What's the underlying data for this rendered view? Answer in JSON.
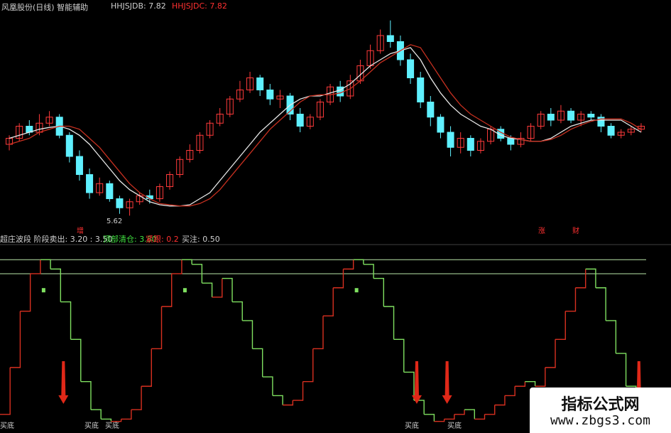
{
  "top_header": {
    "stock_name": "风凰股份(日线) 智能辅助",
    "db_label": "HHJSJDB: 7.82",
    "dc_label": "HHJSJDC: 7.82"
  },
  "top_annotations": {
    "low_price": "5.62",
    "low_tag": "增",
    "right_tags": [
      "涨",
      "财"
    ]
  },
  "bottom_header": {
    "indicator_name": "超庄波段 阶段卖出: 3.20 : 3.50",
    "top_clear": "顶部清仓: 3.50",
    "escape": "紧跟: 0.2",
    "fill": "买注: 0.50"
  },
  "buy_labels": [
    "买底",
    "买底",
    "买底",
    "买底",
    "买底"
  ],
  "watermark": {
    "line1": "指标公式网",
    "line2": "www.zbgs3.com"
  },
  "colors": {
    "up": "#ff3a3a",
    "down": "#5ff0ff",
    "ma_white": "#e8e8e8",
    "ma_red": "#c83020",
    "osc_red": "#d83020",
    "osc_green": "#7fe060",
    "hline": "#b9e6a8",
    "arrow": "#e02818",
    "header_white": "#d0d0d0",
    "header_red": "#ff3030",
    "header_green": "#40e040",
    "header_yellow": "#e0c000"
  },
  "chart_data": [
    {
      "type": "candlestick",
      "title": "风凰股份(日线)",
      "series": [
        {
          "name": "HHJSJDB",
          "kind": "ma_white",
          "values": [
            6.9,
            6.95,
            7.0,
            7.05,
            7.08,
            7.1,
            7.05,
            6.95,
            6.8,
            6.6,
            6.4,
            6.2,
            6.05,
            5.95,
            5.85,
            5.8,
            5.78,
            5.78,
            5.8,
            5.9,
            6.0,
            6.2,
            6.4,
            6.6,
            6.8,
            7.0,
            7.15,
            7.3,
            7.45,
            7.55,
            7.6,
            7.6,
            7.65,
            7.7,
            7.8,
            7.95,
            8.1,
            8.2,
            8.3,
            8.35,
            8.4,
            8.2,
            7.9,
            7.65,
            7.45,
            7.3,
            7.2,
            7.1,
            7.05,
            6.95,
            6.9,
            6.88,
            6.85,
            6.85,
            6.9,
            7.0,
            7.1,
            7.15,
            7.2,
            7.2,
            7.2,
            7.2,
            7.1,
            7.0
          ]
        },
        {
          "name": "HHJSJDC",
          "kind": "ma_red",
          "values": [
            6.8,
            6.85,
            6.9,
            7.0,
            7.05,
            7.1,
            7.1,
            7.05,
            6.9,
            6.75,
            6.55,
            6.35,
            6.15,
            6.0,
            5.9,
            5.82,
            5.8,
            5.78,
            5.78,
            5.82,
            5.9,
            6.05,
            6.25,
            6.45,
            6.65,
            6.85,
            7.05,
            7.2,
            7.35,
            7.5,
            7.6,
            7.62,
            7.62,
            7.65,
            7.72,
            7.85,
            8.0,
            8.15,
            8.25,
            8.35,
            8.45,
            8.4,
            8.15,
            7.9,
            7.65,
            7.45,
            7.3,
            7.2,
            7.1,
            7.0,
            6.92,
            6.88,
            6.85,
            6.85,
            6.88,
            6.95,
            7.05,
            7.12,
            7.18,
            7.22,
            7.22,
            7.22,
            7.15,
            7.05
          ]
        }
      ],
      "candles": [
        [
          6.8,
          6.9,
          6.7,
          6.95
        ],
        [
          6.9,
          7.1,
          6.85,
          7.15
        ],
        [
          7.1,
          7.0,
          6.95,
          7.2
        ],
        [
          7.0,
          7.15,
          6.95,
          7.3
        ],
        [
          7.15,
          7.25,
          7.1,
          7.35
        ],
        [
          7.25,
          6.95,
          6.9,
          7.3
        ],
        [
          6.95,
          6.6,
          6.5,
          7.0
        ],
        [
          6.6,
          6.3,
          6.2,
          6.7
        ],
        [
          6.3,
          6.0,
          5.9,
          6.4
        ],
        [
          6.0,
          6.15,
          5.95,
          6.25
        ],
        [
          6.15,
          5.9,
          5.85,
          6.2
        ],
        [
          5.9,
          5.75,
          5.65,
          5.95
        ],
        [
          5.75,
          5.85,
          5.62,
          5.9
        ],
        [
          5.85,
          5.95,
          5.8,
          6.0
        ],
        [
          5.95,
          5.9,
          5.82,
          6.05
        ],
        [
          5.9,
          6.1,
          5.85,
          6.15
        ],
        [
          6.1,
          6.3,
          6.05,
          6.35
        ],
        [
          6.3,
          6.55,
          6.25,
          6.6
        ],
        [
          6.55,
          6.7,
          6.5,
          6.8
        ],
        [
          6.7,
          6.95,
          6.65,
          7.0
        ],
        [
          6.95,
          7.15,
          6.9,
          7.2
        ],
        [
          7.15,
          7.3,
          7.1,
          7.4
        ],
        [
          7.3,
          7.55,
          7.25,
          7.6
        ],
        [
          7.55,
          7.7,
          7.5,
          7.85
        ],
        [
          7.7,
          7.9,
          7.65,
          8.0
        ],
        [
          7.9,
          7.7,
          7.6,
          7.95
        ],
        [
          7.7,
          7.55,
          7.45,
          7.8
        ],
        [
          7.55,
          7.6,
          7.4,
          7.7
        ],
        [
          7.6,
          7.3,
          7.2,
          7.65
        ],
        [
          7.3,
          7.1,
          7.0,
          7.4
        ],
        [
          7.1,
          7.25,
          7.05,
          7.3
        ],
        [
          7.25,
          7.5,
          7.2,
          7.55
        ],
        [
          7.5,
          7.75,
          7.45,
          7.8
        ],
        [
          7.75,
          7.6,
          7.5,
          7.85
        ],
        [
          7.6,
          7.85,
          7.55,
          7.95
        ],
        [
          7.85,
          8.1,
          7.8,
          8.2
        ],
        [
          8.1,
          8.35,
          8.05,
          8.45
        ],
        [
          8.35,
          8.6,
          8.3,
          8.7
        ],
        [
          8.6,
          8.5,
          8.4,
          8.85
        ],
        [
          8.5,
          8.2,
          8.1,
          8.6
        ],
        [
          8.2,
          7.9,
          7.8,
          8.3
        ],
        [
          7.9,
          7.5,
          7.4,
          8.0
        ],
        [
          7.5,
          7.25,
          7.1,
          7.6
        ],
        [
          7.25,
          7.0,
          6.9,
          7.3
        ],
        [
          7.0,
          6.75,
          6.6,
          7.1
        ],
        [
          6.75,
          6.9,
          6.65,
          7.0
        ],
        [
          6.9,
          6.7,
          6.6,
          6.95
        ],
        [
          6.7,
          6.85,
          6.65,
          6.9
        ],
        [
          6.85,
          7.05,
          6.8,
          7.1
        ],
        [
          7.05,
          6.9,
          6.85,
          7.1
        ],
        [
          6.9,
          6.8,
          6.7,
          6.95
        ],
        [
          6.8,
          6.9,
          6.75,
          7.0
        ],
        [
          6.9,
          7.1,
          6.85,
          7.15
        ],
        [
          7.1,
          7.3,
          7.05,
          7.35
        ],
        [
          7.3,
          7.2,
          7.1,
          7.4
        ],
        [
          7.2,
          7.35,
          7.15,
          7.45
        ],
        [
          7.35,
          7.2,
          7.15,
          7.4
        ],
        [
          7.2,
          7.3,
          7.1,
          7.35
        ],
        [
          7.3,
          7.25,
          7.2,
          7.35
        ],
        [
          7.25,
          7.1,
          7.0,
          7.3
        ],
        [
          7.1,
          6.95,
          6.9,
          7.15
        ],
        [
          6.95,
          7.0,
          6.9,
          7.05
        ],
        [
          7.0,
          7.05,
          6.95,
          7.1
        ],
        [
          7.05,
          7.1,
          7.0,
          7.15
        ]
      ],
      "ylim": [
        5.4,
        9.0
      ]
    },
    {
      "type": "line",
      "title": "超庄波段",
      "values": [
        0.2,
        1.2,
        2.4,
        3.2,
        3.5,
        3.3,
        2.6,
        1.8,
        0.9,
        0.3,
        0.1,
        0.05,
        0.1,
        0.3,
        0.8,
        1.6,
        2.5,
        3.2,
        3.5,
        3.4,
        3.0,
        2.7,
        3.1,
        2.6,
        2.2,
        1.6,
        1.0,
        0.6,
        0.4,
        0.5,
        0.9,
        1.6,
        2.3,
        2.9,
        3.3,
        3.5,
        3.4,
        3.1,
        2.5,
        1.8,
        1.1,
        0.5,
        0.2,
        0.05,
        0.1,
        0.2,
        0.3,
        0.1,
        0.2,
        0.4,
        0.6,
        0.8,
        0.9,
        0.8,
        1.2,
        1.8,
        2.4,
        2.9,
        3.3,
        2.9,
        2.2,
        1.5,
        0.8,
        0.3
      ],
      "phases": [
        "up",
        "up",
        "up",
        "up",
        "flat",
        "dn",
        "dn",
        "dn",
        "dn",
        "dn",
        "dn",
        "dn",
        "up",
        "up",
        "up",
        "up",
        "up",
        "up",
        "flat",
        "dn",
        "dn",
        "dn",
        "up",
        "dn",
        "dn",
        "dn",
        "dn",
        "dn",
        "dn",
        "up",
        "up",
        "up",
        "up",
        "up",
        "up",
        "flat",
        "dn",
        "dn",
        "dn",
        "dn",
        "dn",
        "dn",
        "dn",
        "dn",
        "up",
        "up",
        "up",
        "dn",
        "up",
        "up",
        "up",
        "up",
        "up",
        "dn",
        "up",
        "up",
        "up",
        "up",
        "up",
        "dn",
        "dn",
        "dn",
        "dn",
        "dn"
      ],
      "hlines": [
        3.2,
        3.5
      ],
      "ylim": [
        0,
        3.7
      ],
      "arrows": [
        6,
        41,
        44,
        63
      ],
      "buy_marks": [
        2,
        6,
        8,
        41,
        44
      ]
    }
  ]
}
